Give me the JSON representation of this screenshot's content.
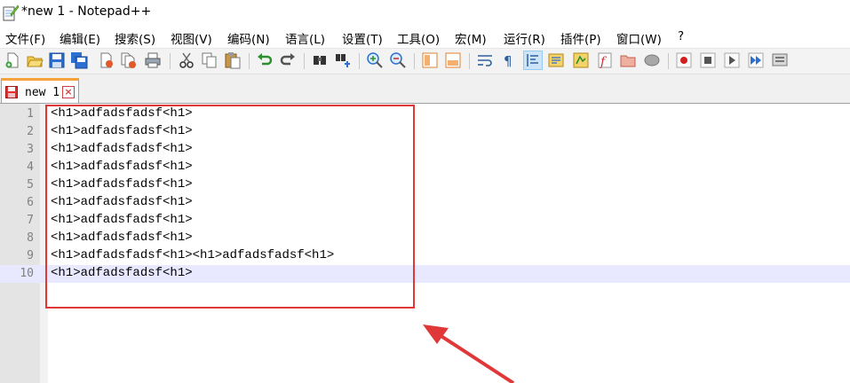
{
  "window": {
    "title": "*new 1 - Notepad++"
  },
  "menu": [
    {
      "label": "文件(F)"
    },
    {
      "label": "编辑(E)"
    },
    {
      "label": "搜索(S)"
    },
    {
      "label": "视图(V)"
    },
    {
      "label": "编码(N)"
    },
    {
      "label": "语言(L)"
    },
    {
      "label": "设置(T)"
    },
    {
      "label": "工具(O)"
    },
    {
      "label": "宏(M)"
    },
    {
      "label": "运行(R)"
    },
    {
      "label": "插件(P)"
    },
    {
      "label": "窗口(W)"
    },
    {
      "label": "?"
    }
  ],
  "toolbar": {
    "icons": [
      "new-file-icon",
      "open-file-icon",
      "save-icon",
      "save-all-icon",
      "close-icon",
      "close-all-icon",
      "print-icon",
      "cut-icon",
      "copy-icon",
      "paste-icon",
      "undo-icon",
      "redo-icon",
      "find-icon",
      "replace-icon",
      "zoom-in-icon",
      "zoom-out-icon",
      "sync-vertical-icon",
      "sync-horizontal-icon",
      "word-wrap-icon",
      "show-all-chars-icon",
      "indent-guide-icon",
      "doc-map-icon",
      "function-list-icon",
      "folder-workspace-icon",
      "monitoring-icon",
      "record-macro-icon",
      "stop-record-icon",
      "play-macro-icon",
      "run-macro-multiple-icon",
      "save-macro-icon"
    ],
    "active": "indent-guide-icon"
  },
  "tab": {
    "label": "new 1",
    "close_symbol": "×"
  },
  "editor": {
    "lines": [
      {
        "num": "1",
        "text": "<h1>adfadsfadsf<h1>"
      },
      {
        "num": "2",
        "text": "<h1>adfadsfadsf<h1>"
      },
      {
        "num": "3",
        "text": "<h1>adfadsfadsf<h1>"
      },
      {
        "num": "4",
        "text": "<h1>adfadsfadsf<h1>"
      },
      {
        "num": "5",
        "text": "<h1>adfadsfadsf<h1>"
      },
      {
        "num": "6",
        "text": "<h1>adfadsfadsf<h1>"
      },
      {
        "num": "7",
        "text": "<h1>adfadsfadsf<h1>"
      },
      {
        "num": "8",
        "text": "<h1>adfadsfadsf<h1>"
      },
      {
        "num": "9",
        "text": "<h1>adfadsfadsf<h1><h1>adfadsfadsf<h1>"
      },
      {
        "num": "10",
        "text": "<h1>adfadsfadsf<h1>"
      }
    ],
    "current_line": "10"
  },
  "colors": {
    "annotation": "#e03838",
    "current_line_bg": "#e8e8ff",
    "gutter_bg": "#e4e4e4"
  }
}
